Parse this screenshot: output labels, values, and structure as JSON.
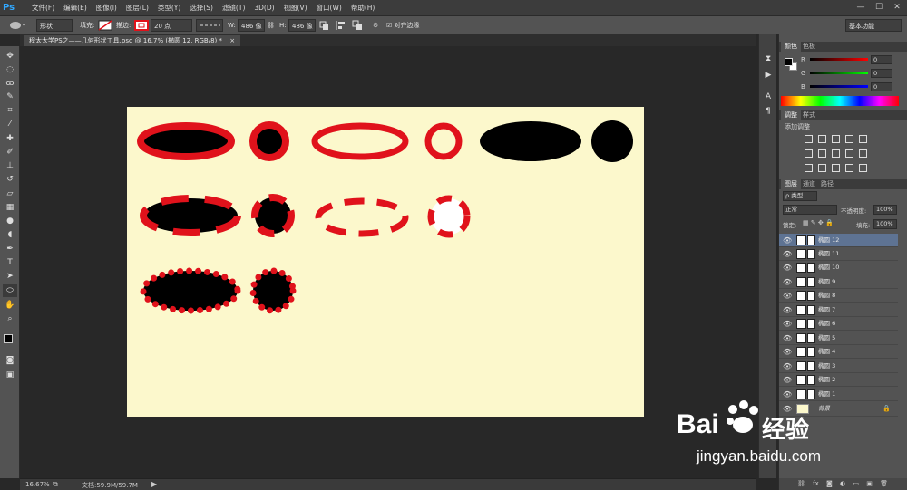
{
  "app": {
    "logo": "Ps"
  },
  "menu": [
    "文件(F)",
    "编辑(E)",
    "图像(I)",
    "图层(L)",
    "类型(Y)",
    "选择(S)",
    "滤镜(T)",
    "3D(D)",
    "视图(V)",
    "窗口(W)",
    "帮助(H)"
  ],
  "window_controls": [
    "—",
    "☐",
    "✕"
  ],
  "options": {
    "mode": "形状",
    "fill_label": "填充:",
    "stroke_label": "描边:",
    "stroke_size": "20 点",
    "w_label": "W:",
    "w_value": "486 像",
    "h_label": "H:",
    "h_value": "486 像",
    "align_edges": "对齐边缘",
    "workspace": "基本功能"
  },
  "document": {
    "tab_title": "程太太学PS之——几何形状工具.psd @ 16.7% (椭圆 12, RGB/8) *",
    "tab_close": "×"
  },
  "status": {
    "zoom": "16.67%",
    "doc": "文档:59.9M/59.7M"
  },
  "colors": {
    "accent_red": "#e0121b",
    "canvas_bg": "#fcf8cc",
    "selected_layer": "#5e7393"
  },
  "panels": {
    "color": {
      "tabs": [
        "颜色",
        "色板"
      ],
      "r": "R",
      "g": "G",
      "b": "B",
      "r_val": "0",
      "g_val": "0",
      "b_val": "0"
    },
    "adjust": {
      "tabs": [
        "调整",
        "样式"
      ],
      "title": "添加调整"
    },
    "layers": {
      "tabs": [
        "图层",
        "通道",
        "路径"
      ],
      "kind": "ρ 类型",
      "blend": "正常",
      "opacity_label": "不透明度:",
      "opacity": "100%",
      "lock_label": "锁定:",
      "fill_label": "填充:",
      "fill": "100%",
      "items": [
        "椭圆 12",
        "椭圆 11",
        "椭圆 10",
        "椭圆 9",
        "椭圆 8",
        "椭圆 7",
        "椭圆 6",
        "椭圆 5",
        "椭圆 4",
        "椭圆 3",
        "椭圆 2",
        "椭圆 1"
      ],
      "background": "背景"
    }
  },
  "watermark": {
    "brand": "Bai",
    "brand_tail": "经验",
    "url": "jingyan.baidu.com"
  }
}
